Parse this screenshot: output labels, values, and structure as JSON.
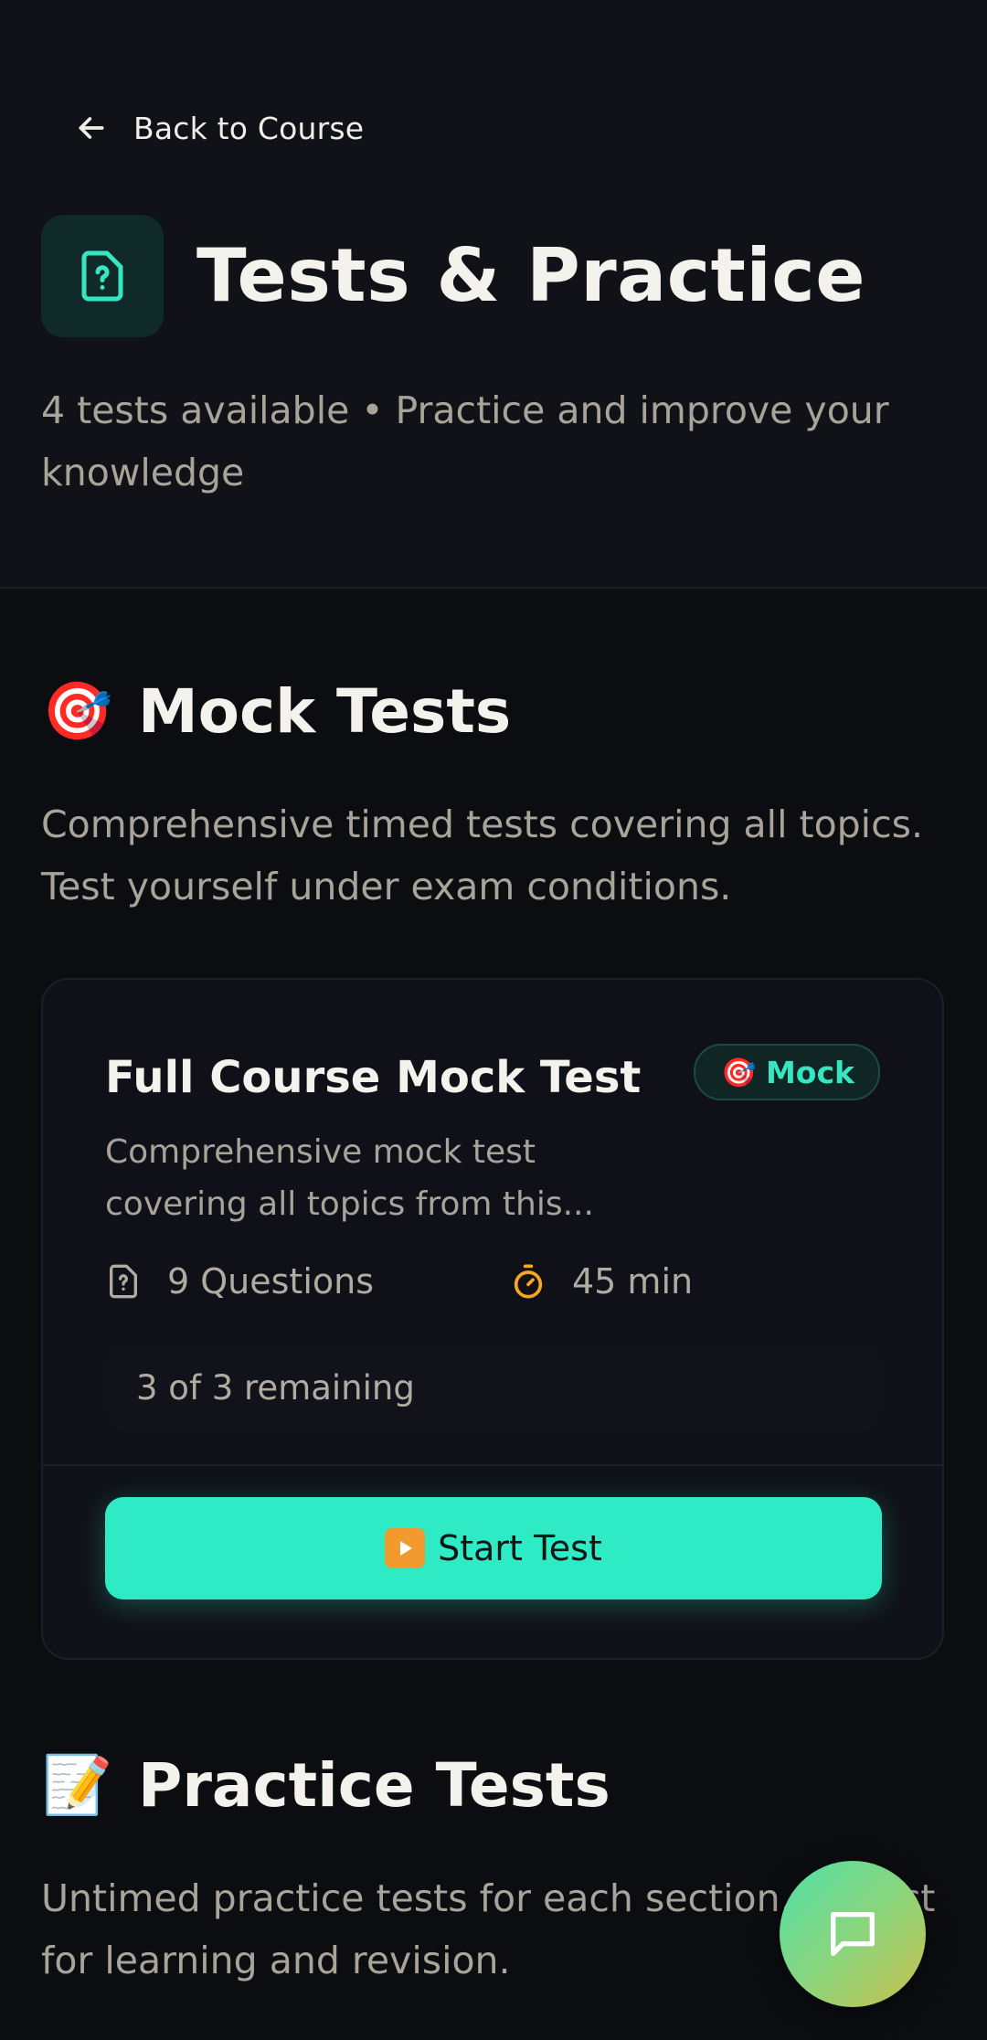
{
  "header": {
    "back_label": "Back to Course",
    "title": "Tests & Practice",
    "subtitle": "4 tests available • Practice and improve your knowledge"
  },
  "sections": [
    {
      "emoji": "🎯",
      "title": "Mock Tests",
      "description": "Comprehensive timed tests covering all topics. Test yourself under exam conditions."
    },
    {
      "emoji": "📝",
      "title": "Practice Tests",
      "description": "Untimed practice tests for each section. Perfect for learning and revision."
    }
  ],
  "mock_card": {
    "title": "Full Course Mock Test",
    "badge_emoji": "🎯",
    "badge_label": "Mock",
    "description": "Comprehensive mock test covering all topics from this...",
    "questions": "9 Questions",
    "duration": "45 min",
    "remaining": "3 of 3 remaining",
    "start_label": "Start Test"
  },
  "colors": {
    "accent": "#2eebc6",
    "background": "#0c0d11",
    "header_bg": "#111217",
    "timer_icon": "#f5a623"
  },
  "icons": {
    "back": "arrow-left-icon",
    "title": "document-question-icon",
    "questions": "document-question-icon",
    "duration": "stopwatch-icon",
    "start": "play-icon",
    "chat": "chat-bubble-icon"
  }
}
